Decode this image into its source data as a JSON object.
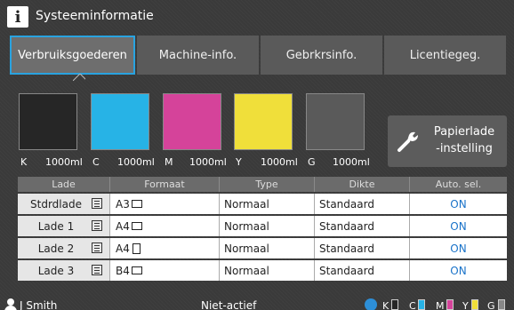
{
  "header": {
    "title": "Systeeminformatie",
    "info_icon_glyph": "i"
  },
  "tabs": [
    {
      "label": "Verbruiksgoederen",
      "active": true
    },
    {
      "label": "Machine-info.",
      "active": false
    },
    {
      "label": "Gebrkrsinfo.",
      "active": false
    },
    {
      "label": "Licentiegeg.",
      "active": false
    }
  ],
  "inks": [
    {
      "code": "K",
      "amount": "1000ml",
      "color": "#262626"
    },
    {
      "code": "C",
      "amount": "1000ml",
      "color": "#27b3e6"
    },
    {
      "code": "M",
      "amount": "1000ml",
      "color": "#d5439a"
    },
    {
      "code": "Y",
      "amount": "1000ml",
      "color": "#f0df3a"
    },
    {
      "code": "G",
      "amount": "1000ml",
      "color": "#5a5a5a"
    }
  ],
  "paper_button": {
    "line1": "Papierlade",
    "line2": "-instelling",
    "icon": "wrench-icon"
  },
  "table": {
    "headers": [
      "Lade",
      "Formaat",
      "Type",
      "Dikte",
      "Auto. sel."
    ],
    "rows": [
      {
        "lade": "Stdrdlade",
        "formaat": "A3",
        "orientation": "landscape",
        "type": "Normaal",
        "dikte": "Standaard",
        "auto": "ON"
      },
      {
        "lade": "Lade 1",
        "formaat": "A4",
        "orientation": "landscape",
        "type": "Normaal",
        "dikte": "Standaard",
        "auto": "ON"
      },
      {
        "lade": "Lade 2",
        "formaat": "A4",
        "orientation": "portrait",
        "type": "Normaal",
        "dikte": "Standaard",
        "auto": "ON"
      },
      {
        "lade": "Lade 3",
        "formaat": "B4",
        "orientation": "landscape",
        "type": "Normaal",
        "dikte": "Standaard",
        "auto": "ON"
      }
    ]
  },
  "status_bar": {
    "user": "J Smith",
    "state": "Niet-actief",
    "ink_levels": [
      {
        "code": "K",
        "color": "#262626"
      },
      {
        "code": "C",
        "color": "#27b3e6"
      },
      {
        "code": "M",
        "color": "#d5439a"
      },
      {
        "code": "Y",
        "color": "#f0df3a"
      },
      {
        "code": "G",
        "color": "#888888"
      }
    ]
  },
  "colors": {
    "accent": "#29a3e0",
    "on_text": "#1a73c9"
  }
}
